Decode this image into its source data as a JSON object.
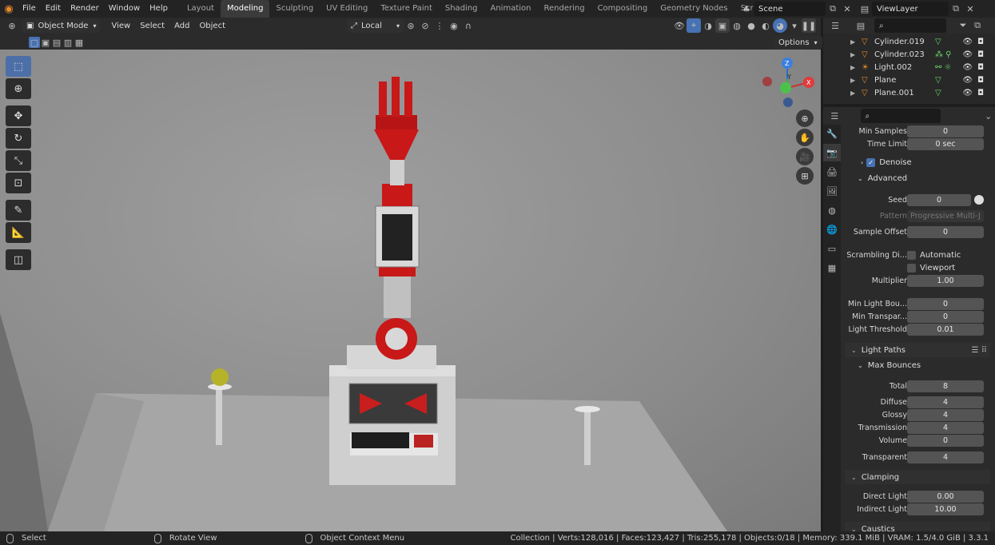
{
  "menu": {
    "items": [
      "File",
      "Edit",
      "Render",
      "Window",
      "Help"
    ]
  },
  "workspaces": {
    "tabs": [
      "Layout",
      "Modeling",
      "Sculpting",
      "UV Editing",
      "Texture Paint",
      "Shading",
      "Animation",
      "Rendering",
      "Compositing",
      "Geometry Nodes",
      "Scripting"
    ],
    "active": "Modeling"
  },
  "scene": {
    "name": "Scene",
    "view_layer": "ViewLayer"
  },
  "header": {
    "mode": "Object Mode",
    "view": "View",
    "select": "Select",
    "add": "Add",
    "object": "Object",
    "transform": "Local",
    "options": "Options"
  },
  "outliner": {
    "items": [
      {
        "name": "Cylinder.019",
        "mods": "▽"
      },
      {
        "name": "Cylinder.023",
        "mods": "⁂ ⚲"
      },
      {
        "name": "Light.002",
        "mods": "⚯ ☼"
      },
      {
        "name": "Plane",
        "mods": "▽"
      },
      {
        "name": "Plane.001",
        "mods": "▽"
      }
    ]
  },
  "props": {
    "min_samples_label": "Min Samples",
    "min_samples": "0",
    "time_limit_label": "Time Limit",
    "time_limit": "0 sec",
    "denoise": "Denoise",
    "advanced": "Advanced",
    "seed_label": "Seed",
    "seed": "0",
    "pattern_label": "Pattern",
    "pattern": "Progressive Multi-J",
    "sample_offset_label": "Sample Offset",
    "sample_offset": "0",
    "scrambling_label": "Scrambling Di...",
    "automatic": "Automatic",
    "viewport": "Viewport",
    "multiplier_label": "Multiplier",
    "multiplier": "1.00",
    "min_light_label": "Min Light Bou...",
    "min_light": "0",
    "min_transp_label": "Min Transpar...",
    "min_transp": "0",
    "light_threshold_label": "Light Threshold",
    "light_threshold": "0.01",
    "light_paths": "Light Paths",
    "max_bounces": "Max Bounces",
    "total_label": "Total",
    "total": "8",
    "diffuse_label": "Diffuse",
    "diffuse": "4",
    "glossy_label": "Glossy",
    "glossy": "4",
    "transmission_label": "Transmission",
    "transmission": "4",
    "volume_label": "Volume",
    "volume": "0",
    "transparent_label": "Transparent",
    "transparent": "4",
    "clamping": "Clamping",
    "direct_label": "Direct Light",
    "direct": "0.00",
    "indirect_label": "Indirect Light",
    "indirect": "10.00",
    "caustics": "Caustics"
  },
  "status": {
    "select": "Select",
    "rotate": "Rotate View",
    "context": "Object Context Menu",
    "stats": "Collection | Verts:128,016 | Faces:123,427 | Tris:255,178 | Objects:0/18 | Memory: 339.1 MiB | VRAM: 1.5/4.0 GiB | 3.3.1"
  },
  "gizmo": {
    "z": "Z",
    "y": "Y",
    "x": "X"
  }
}
